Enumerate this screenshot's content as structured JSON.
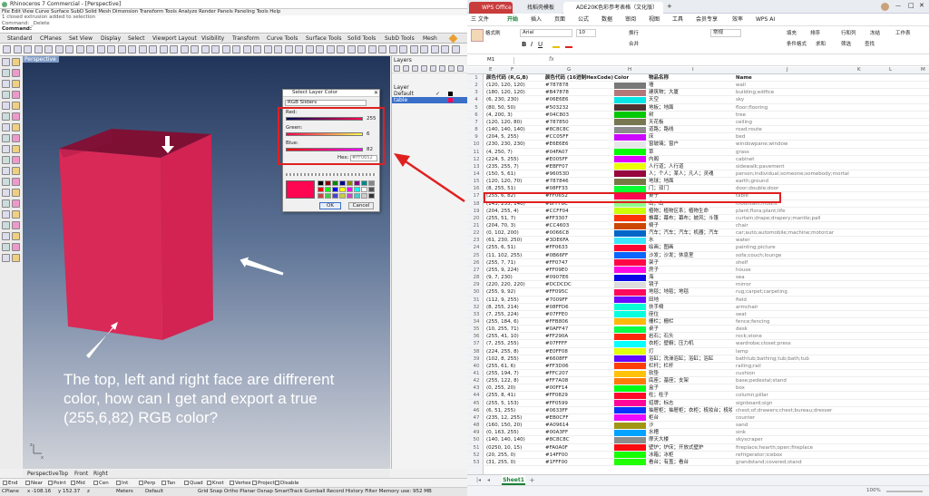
{
  "rhino": {
    "title": "Rhinoceros 7 Commercial - [Perspective]",
    "menu": "File  Edit  View  Curve  Surface  SubD  Solid  Mesh  Dimension  Transform  Tools  Analyze  Render  Panels  Paneling Tools  Help",
    "cmd_history": "1 closed extrusion added to selection",
    "cmd_history2": "Command: _Delete",
    "cmd_prompt": "Command:",
    "tabs": [
      "Standard",
      "CPlanes",
      "Set View",
      "Display",
      "Select",
      "Viewport Layout",
      "Visibility",
      "Transform",
      "Curve Tools",
      "Surface Tools",
      "Solid Tools",
      "SubD Tools",
      "Mesh"
    ],
    "viewport_label": "Perspective",
    "view_tabs": [
      "Perspective",
      "Top",
      "Front",
      "Right"
    ],
    "osnaps": [
      "End",
      "Near",
      "Point",
      "Mid",
      "Cen",
      "Int",
      "Perp",
      "Tan",
      "Quad",
      "Knot",
      "Vertex",
      "Project",
      "Disable"
    ],
    "status": {
      "cplane": "CPlane",
      "x": "x -108.16",
      "y": "y 152.37",
      "z": "z",
      "units": "Meters",
      "default": "Default",
      "modes": "Grid Snap  Ortho  Planar  Osnap SmartTrack Gumball Record History Filter Memory use: 952 MB"
    },
    "layers": {
      "title": "Layers",
      "col": "Layer",
      "rows": [
        "Default",
        "table"
      ],
      "check": "✓"
    },
    "dialog": {
      "title": "Select Layer Color",
      "mode": "RGB Sliders",
      "red_label": "Red:",
      "red": "255",
      "green_label": "Green:",
      "green": "6",
      "blue_label": "Blue:",
      "blue": "82",
      "hex_label": "Hex:",
      "hex": "#FF0652",
      "ok": "OK",
      "cancel": "Cancel",
      "color": "#ff0652"
    },
    "caption": "The top, left and right face are diffrerent\ncolor, how can I get and export a true\n(255,6,82) RGB color?"
  },
  "wps": {
    "tabs": [
      "WPS Office",
      "找稻壳模板",
      "ADE20K色彩参考表格（文化版）"
    ],
    "menu": [
      "三 文件",
      "开始",
      "插入",
      "页面",
      "公式",
      "数据",
      "审阅",
      "视图",
      "工具",
      "会员专享",
      "效率",
      "WPS AI"
    ],
    "ribbon": {
      "paste": "格式刷",
      "font": "Arial",
      "size": "10",
      "format": "常规",
      "cond": "条件格式",
      "fill": "填充",
      "sort": "排序",
      "freeze": "冻结",
      "row": "行和列",
      "sheet": "工作表",
      "wrap": "换行",
      "merge": "合并",
      "sum": "求和",
      "filter": "筛选",
      "find": "查找"
    },
    "cell_ref": "M1",
    "fx": "fx",
    "cols": [
      "E",
      "F",
      "G",
      "H",
      "I",
      "J",
      "K",
      "L",
      "M"
    ],
    "headers": {
      "rgb": "颜色代码 (R,G,B)",
      "hex": "颜色代码 (16进制HexCode)",
      "color": "Color",
      "name_cn": "物品名称",
      "name": "Name"
    },
    "rows": [
      {
        "n": "1",
        "rgb": "",
        "hex": "",
        "c": "",
        "cn": "",
        "en": ""
      },
      {
        "n": "2",
        "rgb": "(120, 120, 120)",
        "hex": "#787878",
        "c": "#787878",
        "cn": "墙",
        "en": "wall"
      },
      {
        "n": "3",
        "rgb": "(180, 120, 120)",
        "hex": "#B47878",
        "c": "#b47878",
        "cn": "建筑物；大厦",
        "en": "building;edifice"
      },
      {
        "n": "4",
        "rgb": "(6, 230, 230)",
        "hex": "#06E6E6",
        "c": "#06e6e6",
        "cn": "天空",
        "en": "sky"
      },
      {
        "n": "5",
        "rgb": "(80, 50, 50)",
        "hex": "#503232",
        "c": "#503232",
        "cn": "地板；地面",
        "en": "floor;flooring"
      },
      {
        "n": "6",
        "rgb": "(4, 200, 3)",
        "hex": "#04C803",
        "c": "#04c803",
        "cn": "树",
        "en": "tree"
      },
      {
        "n": "7",
        "rgb": "(120, 120, 80)",
        "hex": "#787850",
        "c": "#787850",
        "cn": "天花板",
        "en": "ceiling"
      },
      {
        "n": "8",
        "rgb": "(140, 140, 140)",
        "hex": "#8C8C8C",
        "c": "#8c8c8c",
        "cn": "道路；路线",
        "en": "road;route"
      },
      {
        "n": "9",
        "rgb": "(204, 5, 255)",
        "hex": "#CC05FF",
        "c": "#cc05ff",
        "cn": "床",
        "en": "bed"
      },
      {
        "n": "10",
        "rgb": "(230, 230, 230)",
        "hex": "#E6E6E6",
        "c": "#e6e6e6",
        "cn": "窗玻璃；窗户",
        "en": "windowpane;window"
      },
      {
        "n": "11",
        "rgb": "(4, 250, 7)",
        "hex": "#04FA07",
        "c": "#04fa07",
        "cn": "草",
        "en": "grass"
      },
      {
        "n": "12",
        "rgb": "(224, 5, 255)",
        "hex": "#E005FF",
        "c": "#e005ff",
        "cn": "内阁",
        "en": "cabinet"
      },
      {
        "n": "13",
        "rgb": "(235, 255, 7)",
        "hex": "#EBFF07",
        "c": "#ebff07",
        "cn": "人行道；人行道",
        "en": "sidewalk;pavement"
      },
      {
        "n": "14",
        "rgb": "(150, 5, 61)",
        "hex": "#96053D",
        "c": "#96053d",
        "cn": "人；个人；某人；凡人；灵魂",
        "en": "person;individual;someone;somebody;mortal;soul"
      },
      {
        "n": "15",
        "rgb": "(120, 120, 70)",
        "hex": "#787846",
        "c": "#787846",
        "cn": "地球；地面",
        "en": "earth;ground"
      },
      {
        "n": "16",
        "rgb": "(8, 255, 51)",
        "hex": "#08FF33",
        "c": "#08ff33",
        "cn": "门；双门",
        "en": "door;double;door"
      },
      {
        "n": "17",
        "rgb": "(255, 6, 82)",
        "hex": "#FF0652",
        "c": "#ff0652",
        "cn": "桌子",
        "en": "table"
      },
      {
        "n": "18",
        "rgb": "(143, 255, 140)",
        "hex": "#8FFF8C",
        "c": "#8fff8c",
        "cn": "山；山",
        "en": "mountain;mount"
      },
      {
        "n": "19",
        "rgb": "(204, 255, 4)",
        "hex": "#CCFF04",
        "c": "#ccff04",
        "cn": "植物；植物区系；植物生命",
        "en": "plant;flora;plant;life"
      },
      {
        "n": "20",
        "rgb": "(255, 51, 7)",
        "hex": "#FF3307",
        "c": "#ff3307",
        "cn": "帷幕；幕布；幕布；披风；斗篷",
        "en": "curtain;drape;drapery;mantle;pall"
      },
      {
        "n": "21",
        "rgb": "(204, 70, 3)",
        "hex": "#CC4603",
        "c": "#cc4603",
        "cn": "椅子",
        "en": "chair"
      },
      {
        "n": "22",
        "rgb": "(0, 102, 200)",
        "hex": "#0066C8",
        "c": "#0066c8",
        "cn": "汽车；汽车；汽车；机器；汽车",
        "en": "car;auto;automobile;machine;motorcar"
      },
      {
        "n": "23",
        "rgb": "(61, 230, 250)",
        "hex": "#3DE6FA",
        "c": "#3de6fa",
        "cn": "水",
        "en": "water"
      },
      {
        "n": "24",
        "rgb": "(255, 6, 51)",
        "hex": "#FF0633",
        "c": "#ff0633",
        "cn": "绘画；图画",
        "en": "painting;picture"
      },
      {
        "n": "25",
        "rgb": "(11, 102, 255)",
        "hex": "#0B66FF",
        "c": "#0b66ff",
        "cn": "沙发；沙发；休息室",
        "en": "sofa;couch;lounge"
      },
      {
        "n": "26",
        "rgb": "(255, 7, 71)",
        "hex": "#FF0747",
        "c": "#ff0747",
        "cn": "架子",
        "en": "shelf"
      },
      {
        "n": "27",
        "rgb": "(255, 9, 224)",
        "hex": "#FF09E0",
        "c": "#ff09e0",
        "cn": "房子",
        "en": "house"
      },
      {
        "n": "28",
        "rgb": "(9, 7, 230)",
        "hex": "#0907E6",
        "c": "#0907e6",
        "cn": "海",
        "en": "sea"
      },
      {
        "n": "29",
        "rgb": "(220, 220, 220)",
        "hex": "#DCDCDC",
        "c": "#dcdcdc",
        "cn": "镜子",
        "en": "mirror"
      },
      {
        "n": "30",
        "rgb": "(255, 9, 92)",
        "hex": "#FF095C",
        "c": "#ff095c",
        "cn": "地毯；地毯；地毯",
        "en": "rug;carpet;carpeting"
      },
      {
        "n": "31",
        "rgb": "(112, 9, 255)",
        "hex": "#7009FF",
        "c": "#7009ff",
        "cn": "田地",
        "en": "field"
      },
      {
        "n": "32",
        "rgb": "(8, 255, 214)",
        "hex": "#08FFD6",
        "c": "#08ffd6",
        "cn": "扶手椅",
        "en": "armchair"
      },
      {
        "n": "33",
        "rgb": "(7, 255, 224)",
        "hex": "#07FFE0",
        "c": "#07ffe0",
        "cn": "座位",
        "en": "seat"
      },
      {
        "n": "34",
        "rgb": "(255, 184, 6)",
        "hex": "#FFB806",
        "c": "#ffb806",
        "cn": "栅栏；栅栏",
        "en": "fence;fencing"
      },
      {
        "n": "35",
        "rgb": "(10, 255, 71)",
        "hex": "#0AFF47",
        "c": "#0aff47",
        "cn": "桌子",
        "en": "desk"
      },
      {
        "n": "36",
        "rgb": "(255, 41, 10)",
        "hex": "#FF290A",
        "c": "#ff290a",
        "cn": "岩石；石头",
        "en": "rock;stone"
      },
      {
        "n": "37",
        "rgb": "(7, 255, 255)",
        "hex": "#07FFFF",
        "c": "#07ffff",
        "cn": "衣柜；壁橱；压力机",
        "en": "wardrobe;closet;press"
      },
      {
        "n": "38",
        "rgb": "(224, 255, 8)",
        "hex": "#E0FF08",
        "c": "#e0ff08",
        "cn": "灯",
        "en": "lamp"
      },
      {
        "n": "39",
        "rgb": "(102, 8, 255)",
        "hex": "#6608FF",
        "c": "#6608ff",
        "cn": "浴缸；洗澡浴缸；浴缸；浴缸",
        "en": "bathtub;bathing;tub;bath;tub"
      },
      {
        "n": "40",
        "rgb": "(255, 61, 6)",
        "hex": "#FF3D06",
        "c": "#ff3d06",
        "cn": "栏杆；栏杆",
        "en": "railing;rail"
      },
      {
        "n": "41",
        "rgb": "(255, 194, 7)",
        "hex": "#FFC207",
        "c": "#ffc207",
        "cn": "软垫",
        "en": "cushion"
      },
      {
        "n": "42",
        "rgb": "(255, 122, 8)",
        "hex": "#FF7A08",
        "c": "#ff7a08",
        "cn": "底座；基座；支架",
        "en": "base;pedestal;stand"
      },
      {
        "n": "43",
        "rgb": "(0, 255, 20)",
        "hex": "#00FF14",
        "c": "#00ff14",
        "cn": "盒子",
        "en": "box"
      },
      {
        "n": "44",
        "rgb": "(255, 8, 41)",
        "hex": "#FF0829",
        "c": "#ff0829",
        "cn": "柱；柱子",
        "en": "column;pillar"
      },
      {
        "n": "45",
        "rgb": "(255, 5, 153)",
        "hex": "#FF0599",
        "c": "#ff0599",
        "cn": "招牌；标志",
        "en": "signboard;sign"
      },
      {
        "n": "46",
        "rgb": "(6, 51, 255)",
        "hex": "#0633FF",
        "c": "#0633ff",
        "cn": "抽屉柜；抽屉柜；衣柜；梳妆台；梳妆台",
        "en": "chest;of;drawers;chest;bureau;dresser"
      },
      {
        "n": "47",
        "rgb": "(235, 12, 255)",
        "hex": "#EB0CFF",
        "c": "#eb0cff",
        "cn": "柜台",
        "en": "counter"
      },
      {
        "n": "48",
        "rgb": "(160, 150, 20)",
        "hex": "#A09614",
        "c": "#a09614",
        "cn": "沙",
        "en": "sand"
      },
      {
        "n": "49",
        "rgb": "(0, 163, 255)",
        "hex": "#00A3FF",
        "c": "#00a3ff",
        "cn": "水槽",
        "en": "sink"
      },
      {
        "n": "50",
        "rgb": "(140, 140, 140)",
        "hex": "#8C8C8C",
        "c": "#8c8c8c",
        "cn": "摩天大楼",
        "en": "skyscraper"
      },
      {
        "n": "51",
        "rgb": "(0250, 10, 15)",
        "hex": "#FA0A0F",
        "c": "#fa0a0f",
        "cn": "壁炉；炉床；开放式壁炉",
        "en": "fireplace;hearth;open;fireplace"
      },
      {
        "n": "52",
        "rgb": "(20, 255, 0)",
        "hex": "#14FF00",
        "c": "#14ff00",
        "cn": "冰箱；冰柜",
        "en": "refrigerator;icebox"
      },
      {
        "n": "53",
        "rgb": "(31, 255, 0)",
        "hex": "#1FFF00",
        "c": "#1fff00",
        "cn": "看台；有盖；看台",
        "en": "grandstand;covered;stand"
      }
    ],
    "sheet": "Sheet1",
    "status": {
      "zoom": "100%"
    }
  }
}
